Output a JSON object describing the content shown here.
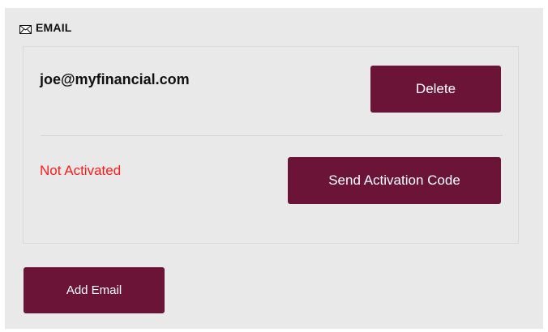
{
  "section": {
    "title": "EMAIL",
    "icon": "envelope-icon"
  },
  "email_entry": {
    "address": "joe@myfinancial.com",
    "delete_label": "Delete",
    "status": "Not Activated",
    "send_code_label": "Send Activation Code"
  },
  "actions": {
    "add_email_label": "Add Email"
  },
  "colors": {
    "button_bg": "#6b1438",
    "status_red": "#ff1a1a",
    "panel_bg": "#e9e9e9"
  }
}
